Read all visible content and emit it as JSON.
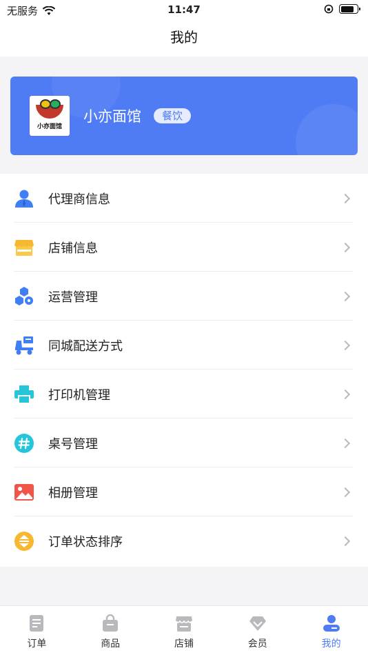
{
  "status_bar": {
    "carrier": "无服务",
    "time": "11:47"
  },
  "nav": {
    "title": "我的"
  },
  "profile": {
    "shop_name": "小亦面馆",
    "category_tag": "餐饮",
    "logo_text": "小亦面馆"
  },
  "menu": {
    "items": [
      {
        "label": "代理商信息",
        "icon": "person-icon",
        "color": "#3f7ef5"
      },
      {
        "label": "店铺信息",
        "icon": "store-icon",
        "color": "#f7b731"
      },
      {
        "label": "运营管理",
        "icon": "hexagon-gear-icon",
        "color": "#3f7ef5"
      },
      {
        "label": "同城配送方式",
        "icon": "delivery-scooter-icon",
        "color": "#3f7ef5"
      },
      {
        "label": "打印机管理",
        "icon": "printer-icon",
        "color": "#26c6da"
      },
      {
        "label": "桌号管理",
        "icon": "hashtag-icon",
        "color": "#26c6da"
      },
      {
        "label": "相册管理",
        "icon": "photo-album-icon",
        "color": "#f0554a"
      },
      {
        "label": "订单状态排序",
        "icon": "sort-icon",
        "color": "#f7b731"
      }
    ]
  },
  "tabbar": {
    "tabs": [
      {
        "label": "订单",
        "icon": "order-icon"
      },
      {
        "label": "商品",
        "icon": "bag-icon"
      },
      {
        "label": "店铺",
        "icon": "shop-icon"
      },
      {
        "label": "会员",
        "icon": "diamond-icon"
      },
      {
        "label": "我的",
        "icon": "profile-icon"
      }
    ],
    "active_index": 4,
    "active_color": "#4f7cf5",
    "inactive_color": "#b9b9bd"
  }
}
